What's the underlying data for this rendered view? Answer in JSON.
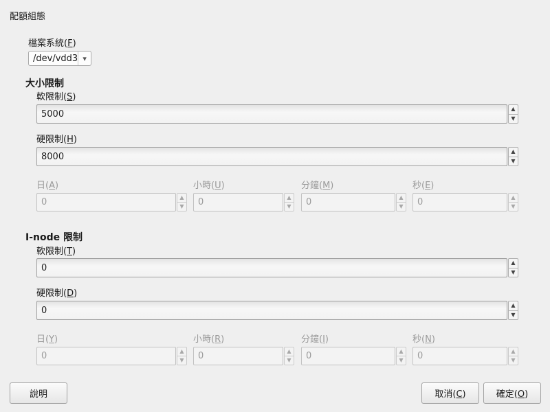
{
  "dialog": {
    "title": "配額組態"
  },
  "filesystem": {
    "label_pre": "檔案系統(",
    "label_key": "F",
    "label_post": ")",
    "value": "/dev/vdd3",
    "arrow": "chevron-down-icon"
  },
  "size_limits": {
    "heading": "大小限制",
    "soft": {
      "label_pre": "軟限制(",
      "label_key": "S",
      "label_post": ")",
      "value": "5000"
    },
    "hard": {
      "label_pre": "硬限制(",
      "label_key": "H",
      "label_post": ")",
      "value": "8000"
    },
    "grace": {
      "days": {
        "label_pre": "日(",
        "label_key": "A",
        "label_post": ")",
        "value": "0"
      },
      "hours": {
        "label_pre": "小時(",
        "label_key": "U",
        "label_post": ")",
        "value": "0"
      },
      "minutes": {
        "label_pre": "分鐘(",
        "label_key": "M",
        "label_post": ")",
        "value": "0"
      },
      "seconds": {
        "label_pre": "秒(",
        "label_key": "E",
        "label_post": ")",
        "value": "0"
      }
    }
  },
  "inode_limits": {
    "heading": "I-node 限制",
    "soft": {
      "label_pre": "軟限制(",
      "label_key": "T",
      "label_post": ")",
      "value": "0"
    },
    "hard": {
      "label_pre": "硬限制(",
      "label_key": "D",
      "label_post": ")",
      "value": "0"
    },
    "grace": {
      "days": {
        "label_pre": "日(",
        "label_key": "Y",
        "label_post": ")",
        "value": "0"
      },
      "hours": {
        "label_pre": "小時(",
        "label_key": "R",
        "label_post": ")",
        "value": "0"
      },
      "minutes": {
        "label_pre": "分鐘(",
        "label_key": "I",
        "label_post": ")",
        "value": "0"
      },
      "seconds": {
        "label_pre": "秒(",
        "label_key": "N",
        "label_post": ")",
        "value": "0"
      }
    }
  },
  "buttons": {
    "help": "說明",
    "cancel": {
      "pre": "取消(",
      "key": "C",
      "post": ")"
    },
    "ok": {
      "pre": "確定(",
      "key": "O",
      "post": ")"
    }
  }
}
